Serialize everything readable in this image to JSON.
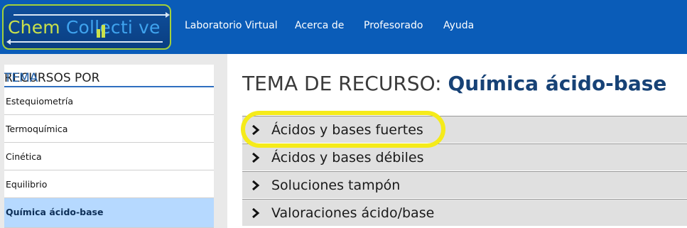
{
  "logo": {
    "word1": "Chem",
    "word2_a": "Co",
    "word2_b": "ll",
    "word2_c": "ecti",
    "word2_d": "ve",
    "label": "ChemCollective"
  },
  "nav": {
    "items": [
      {
        "label": "Laboratorio Virtual"
      },
      {
        "label": "Acerca de"
      },
      {
        "label": "Profesorado"
      },
      {
        "label": "Ayuda"
      }
    ]
  },
  "sidebar": {
    "heading_part1": "RECURSOS POR",
    "heading_part2": "TEMA",
    "items": [
      {
        "label": "Estequiometría"
      },
      {
        "label": "Termoquímica"
      },
      {
        "label": "Cinética"
      },
      {
        "label": "Equilibrio"
      },
      {
        "label": "Química ácido-base",
        "active": true
      }
    ]
  },
  "main": {
    "title_prefix": "TEMA DE RECURSO:",
    "title_topic": "Química ácido-base",
    "sections": [
      {
        "label": "Ácidos y bases fuertes",
        "highlighted": true
      },
      {
        "label": "Ácidos y bases débiles"
      },
      {
        "label": "Soluciones tampón"
      },
      {
        "label": "Valoraciones ácido/base"
      }
    ]
  },
  "colors": {
    "header_bg": "#0a5cb8",
    "logo_green": "#c9e14b",
    "logo_blue": "#3fa3ee",
    "active_item_bg": "#b6d9ff",
    "title_topic": "#174276",
    "highlight_ring": "#f5eb1a"
  },
  "icons": {
    "section_toggle": "chevron-right-icon"
  }
}
